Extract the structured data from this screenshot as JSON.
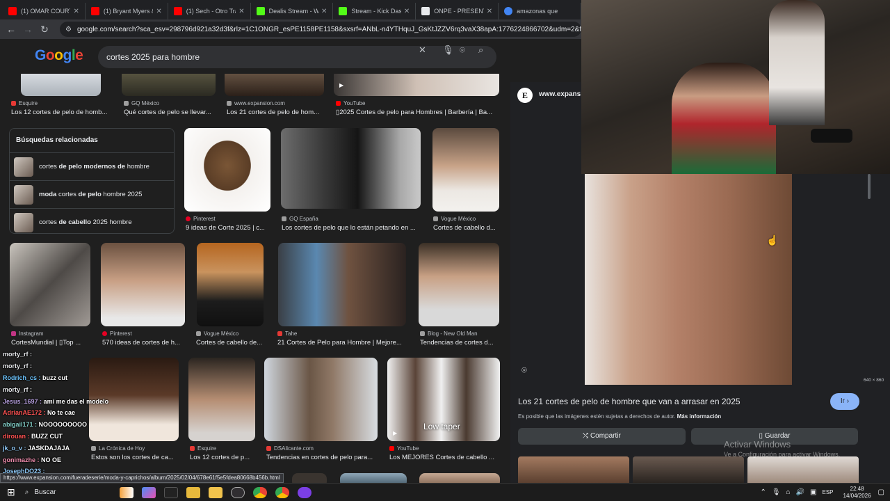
{
  "browser": {
    "tabs": [
      {
        "title": "(1) OMAR COURTZ ((",
        "color": "#ff0000"
      },
      {
        "title": "(1) Bryant Myers & Ba",
        "color": "#ff0000"
      },
      {
        "title": "(1) Sech - Otro Trago",
        "color": "#ff0000"
      },
      {
        "title": "Dealis Stream - Watc",
        "color": "#53fc18"
      },
      {
        "title": "Stream - Kick Dashbo",
        "color": "#53fc18"
      },
      {
        "title": "ONPE - PRESENTACIÓ",
        "color": "#e8eaed"
      },
      {
        "title": "amazonas que",
        "color": "#4285f4"
      }
    ],
    "url": "google.com/search?sca_esv=298796d921a32d3f&rlz=1C1ONGR_esPE1158PE1158&sxsrf=ANbL-n4YTHquJ_GsKtJZZV6rq3vaX38apA:1776224866702&udm=2&fbs=ADc_l-bpk8W4",
    "status_url": "https://www.expansion.com/fueradeserie/moda-y-caprichos/album/2025/02/04/678e61f5e5fdea80668b456b.html"
  },
  "google": {
    "logo": "Google",
    "query": "cortes 2025 para hombre"
  },
  "row0": [
    {
      "source": "Esquire",
      "caption": "Los 12 cortes de pelo de homb...",
      "color": "#e53935"
    },
    {
      "source": "GQ México",
      "caption": "Qué cortes de pelo se llevar...",
      "color": "#9e9e9e"
    },
    {
      "source": "www.expansion.com",
      "caption": "Los 21 cortes de pelo de hom...",
      "color": "#9e9e9e"
    },
    {
      "source": "YouTube",
      "caption": "▯2025 Cortes de pelo para Hombres | Barbería | Ba...",
      "color": "#ff0000"
    }
  ],
  "related": {
    "heading": "Búsquedas relacionadas",
    "items": [
      {
        "pre": "cortes ",
        "bold1": "de pelo modernos de",
        "post": " hombre",
        "bold2": "",
        "tail": ""
      },
      {
        "pre": "",
        "bold1": "moda",
        "post": " cortes ",
        "bold2": "de pelo",
        "tail": " hombre 2025"
      },
      {
        "pre": "cortes ",
        "bold1": "de cabello",
        "post": " 2025 hombre",
        "bold2": "",
        "tail": ""
      }
    ]
  },
  "row1": [
    {
      "source": "Pinterest",
      "caption": "9 ideas de Corte 2025 | c...",
      "color": "#e60023"
    },
    {
      "source": "GQ España",
      "caption": "Los cortes de pelo que lo están petando en ...",
      "color": "#9e9e9e"
    },
    {
      "source": "Vogue México",
      "caption": "Cortes de cabello d...",
      "color": "#9e9e9e"
    }
  ],
  "row2": [
    {
      "source": "Instagram",
      "caption": "CortesMundial | ▯Top ...",
      "color": "#c13584"
    },
    {
      "source": "Pinterest",
      "caption": "570 ideas de cortes de h...",
      "color": "#e60023"
    },
    {
      "source": "Vogue México",
      "caption": "Cortes de cabello de...",
      "color": "#9e9e9e"
    },
    {
      "source": "Tahe",
      "caption": "21 Cortes de Pelo para Hombre | Mejore...",
      "color": "#e53935"
    },
    {
      "source": "Blog - New Old Man",
      "caption": "Tendencias de cortes d...",
      "color": "#9e9e9e"
    }
  ],
  "row3": [
    {
      "source": "La Crónica de Hoy",
      "caption": "Estos son los cortes de ca...",
      "color": "#9e9e9e"
    },
    {
      "source": "Esquire",
      "caption": "Los 12 cortes de p...",
      "color": "#e53935"
    },
    {
      "source": "DSAlicante.com",
      "caption": "Tendencias en cortes de pelo para...",
      "color": "#e53935"
    },
    {
      "source": "YouTube",
      "caption": "Los MEJORES Cortes de cabello ...",
      "color": "#ff0000"
    }
  ],
  "video_overlay": "Low taper",
  "panel": {
    "site": "www.expansion",
    "site_initial": "E",
    "dimensions": "640 × 860",
    "title": "Los 21 cortes de pelo de hombre que van a arrasar en 2025",
    "go": "Ir",
    "notice": "Es posible que las imágenes estén sujetas a derechos de autor.",
    "more": "Más información",
    "share": "Compartir",
    "save": "Guardar"
  },
  "watermark": {
    "line1": "Activar Windows",
    "line2": "Ve a Configuración para activar Windows."
  },
  "chat": [
    {
      "user": "morty_rf :",
      "msg": "",
      "color": "#e8eaed"
    },
    {
      "user": "morty_rf :",
      "msg": "",
      "color": "#e8eaed"
    },
    {
      "user": "Rodrich_cs :",
      "msg": "buzz cut",
      "color": "#6ec6ff"
    },
    {
      "user": "morty_rf :",
      "msg": "",
      "color": "#e8eaed"
    },
    {
      "user": "Jesus_1697 :",
      "msg": "ami me das el modelo",
      "color": "#b39ddb"
    },
    {
      "user": "AdrianAE172 :",
      "msg": "No te cae",
      "color": "#ff5252"
    },
    {
      "user": "abigail171 :",
      "msg": "NOOOOOOOOO",
      "color": "#80cbc4"
    },
    {
      "user": "dirouan :",
      "msg": "BUZZ CUT",
      "color": "#ff5252"
    },
    {
      "user": "jk_o_v :",
      "msg": "JASKDAJAJA",
      "color": "#90caf9"
    },
    {
      "user": "gonimazhe :",
      "msg": "NO OE",
      "color": "#f48fb1"
    },
    {
      "user": "JosephDO23 :",
      "msg": "",
      "color": "#90caf9"
    }
  ],
  "taskbar": {
    "search": "Buscar",
    "lang": "ESP",
    "time": "22:48",
    "date": "14/04/2026"
  }
}
